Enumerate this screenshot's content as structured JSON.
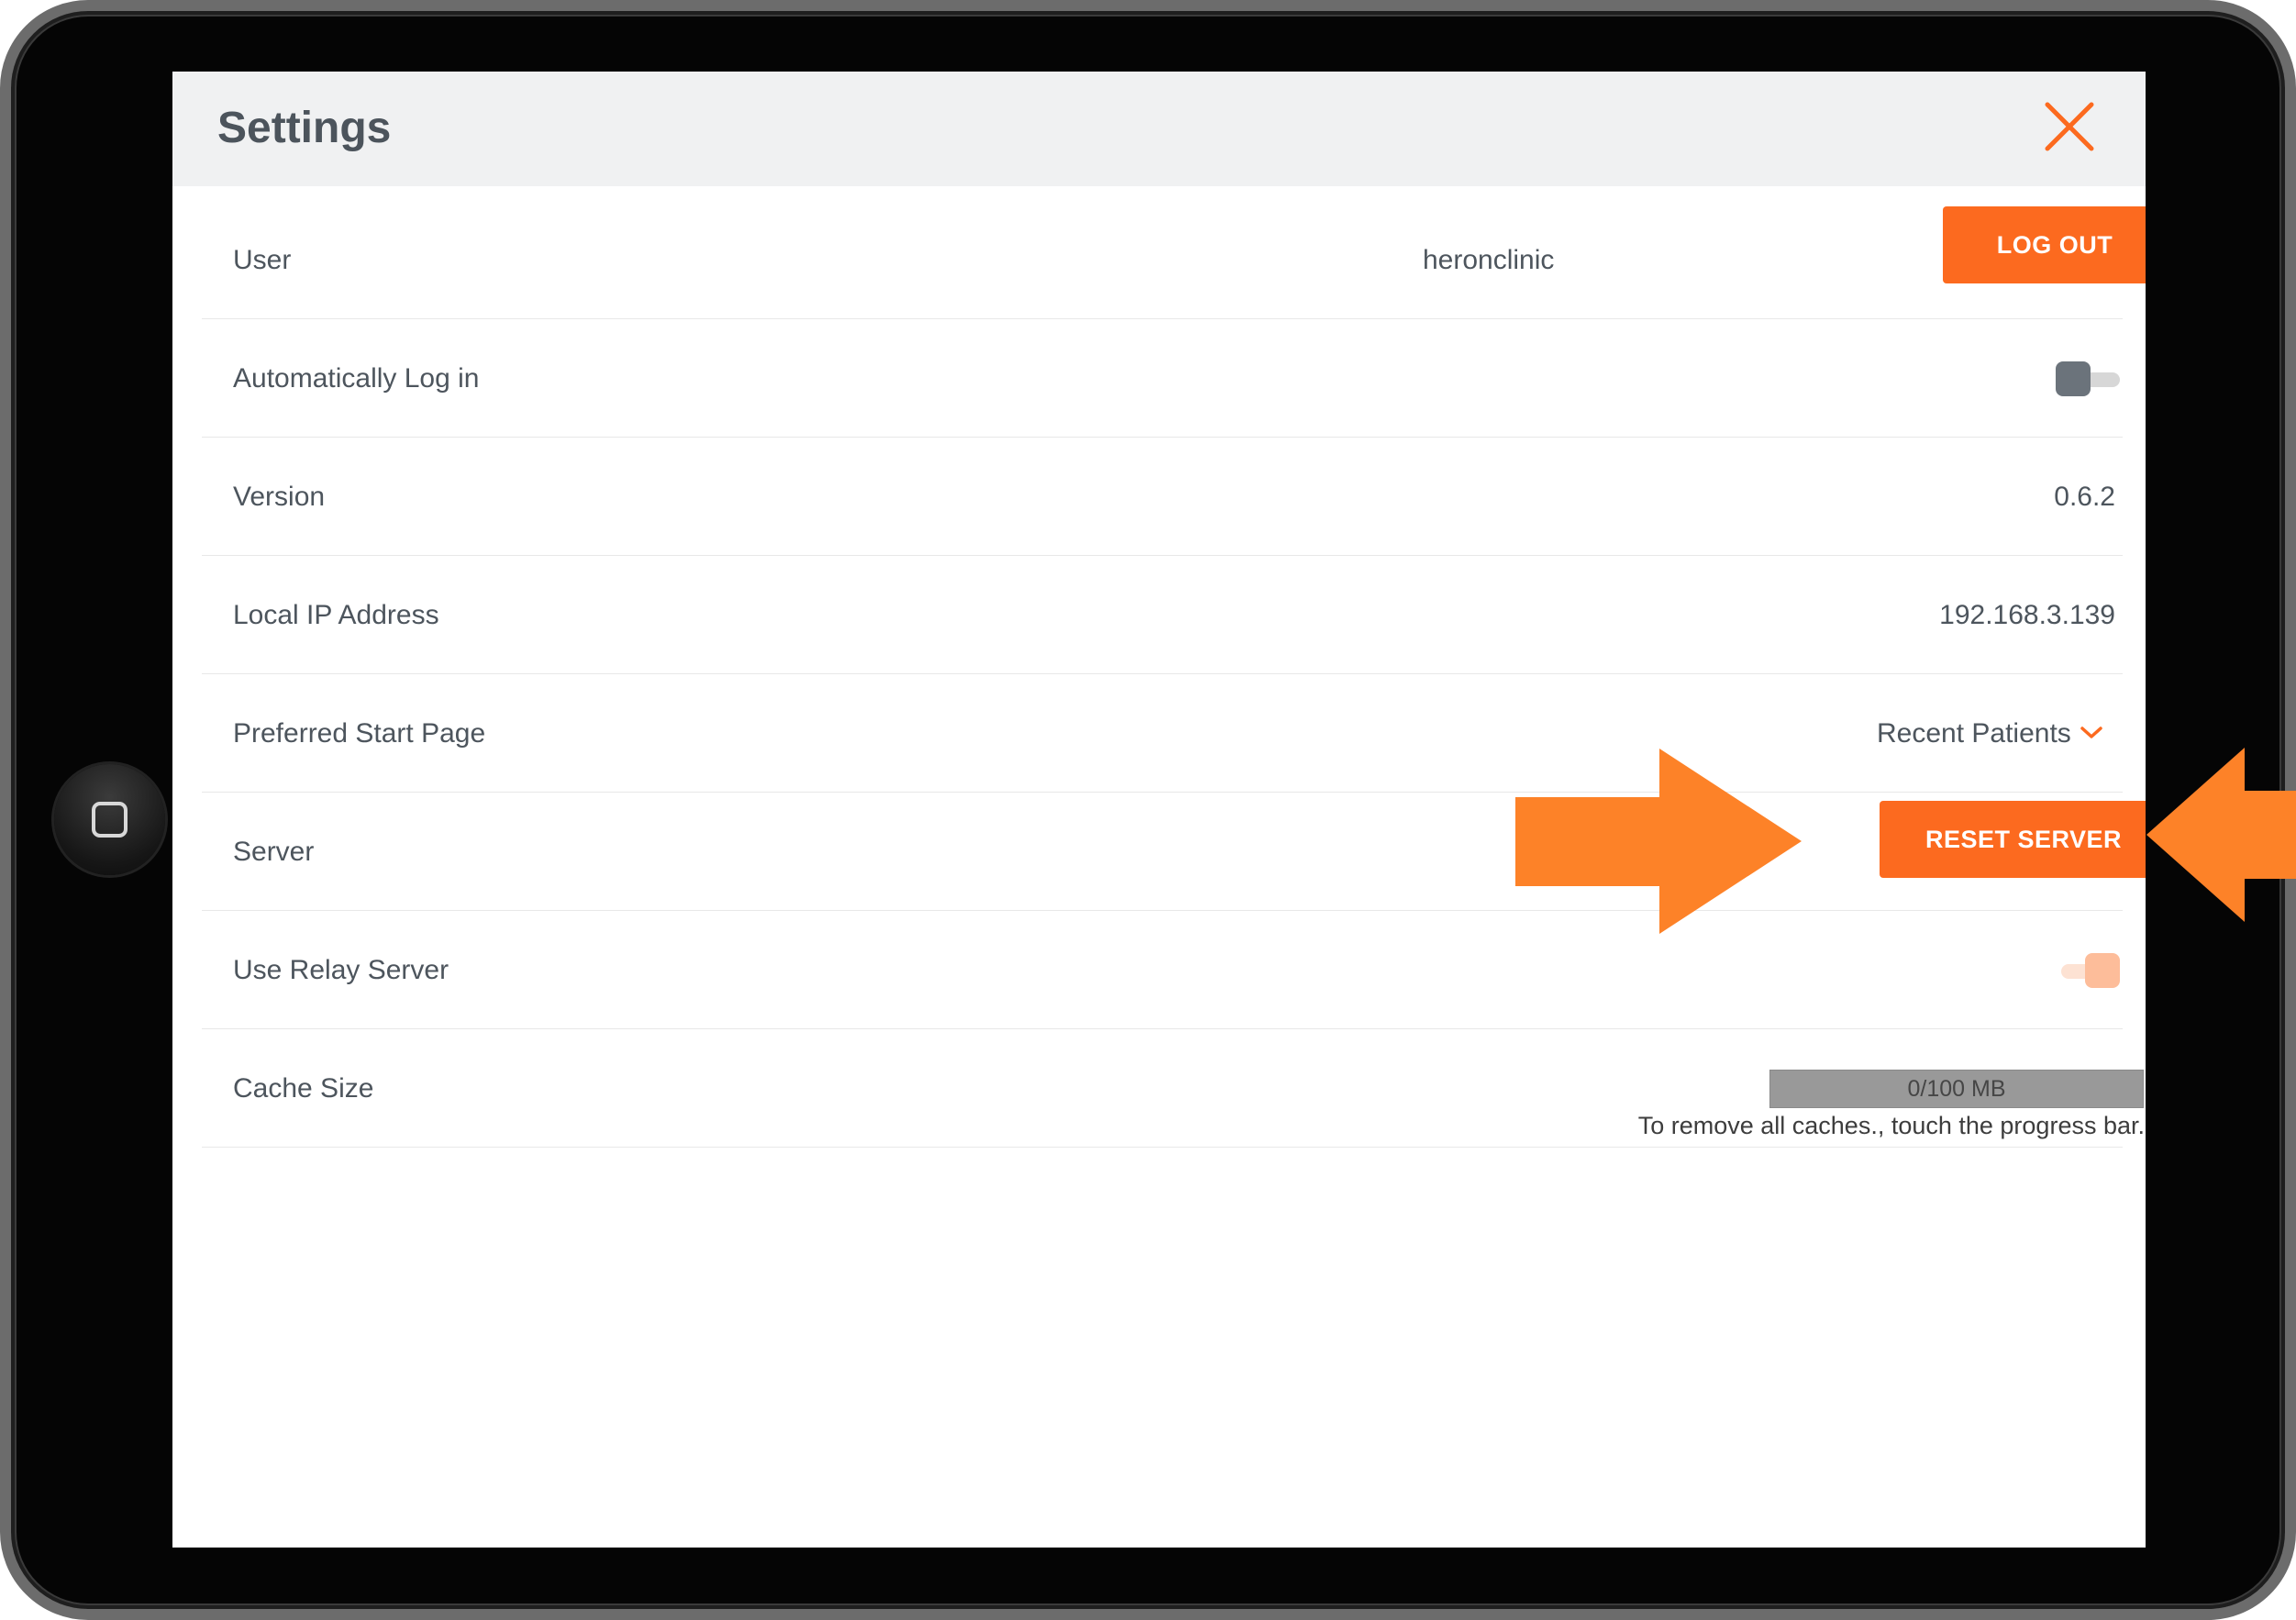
{
  "header": {
    "title": "Settings"
  },
  "rows": {
    "user": {
      "label": "User",
      "value": "heronclinic",
      "button": "LOG OUT"
    },
    "auto_login": {
      "label": "Automatically Log in",
      "on": false
    },
    "version": {
      "label": "Version",
      "value": "0.6.2"
    },
    "ip": {
      "label": "Local IP Address",
      "value": "192.168.3.139"
    },
    "start_page": {
      "label": "Preferred Start Page",
      "value": "Recent Patients"
    },
    "server": {
      "label": "Server",
      "button": "RESET SERVER"
    },
    "relay": {
      "label": "Use Relay Server",
      "on": true
    },
    "cache": {
      "label": "Cache Size",
      "progress_text": "0/100 MB",
      "used_mb": 0,
      "total_mb": 100,
      "hint": "To remove all caches., touch the progress bar."
    }
  },
  "colors": {
    "accent": "#fc6a1f",
    "annotation_arrow": "#fd8228",
    "text": "#4d555d",
    "header_bg": "#f0f1f2"
  },
  "icons": {
    "close": "close-icon",
    "dropdown": "chevron-down-icon",
    "home": "home-button-icon"
  }
}
